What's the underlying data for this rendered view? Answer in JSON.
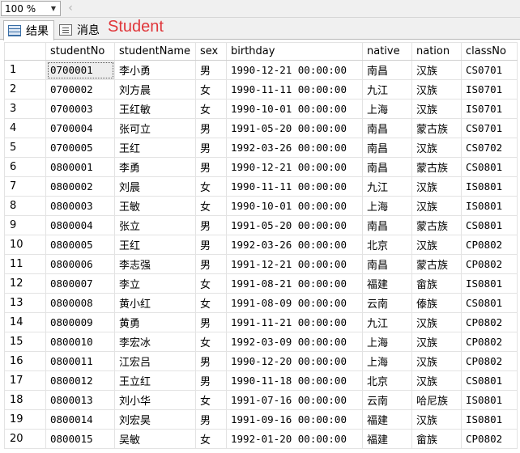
{
  "zoom": {
    "value": "100 %",
    "scroll_glyph": "‹"
  },
  "tabs": [
    {
      "label": "结果"
    },
    {
      "label": "消息"
    }
  ],
  "annotation": "Student",
  "grid": {
    "columns": [
      "studentNo",
      "studentName",
      "sex",
      "birthday",
      "native",
      "nation",
      "classNo"
    ],
    "rows": [
      [
        "1",
        "0700001",
        "李小勇",
        "男",
        "1990-12-21 00:00:00",
        "南昌",
        "汉族",
        "CS0701"
      ],
      [
        "2",
        "0700002",
        "刘方晨",
        "女",
        "1990-11-11 00:00:00",
        "九江",
        "汉族",
        "IS0701"
      ],
      [
        "3",
        "0700003",
        "王红敏",
        "女",
        "1990-10-01 00:00:00",
        "上海",
        "汉族",
        "IS0701"
      ],
      [
        "4",
        "0700004",
        "张可立",
        "男",
        "1991-05-20 00:00:00",
        "南昌",
        "蒙古族",
        "CS0701"
      ],
      [
        "5",
        "0700005",
        "王红",
        "男",
        "1992-03-26 00:00:00",
        "南昌",
        "汉族",
        "CS0702"
      ],
      [
        "6",
        "0800001",
        "李勇",
        "男",
        "1990-12-21 00:00:00",
        "南昌",
        "蒙古族",
        "CS0801"
      ],
      [
        "7",
        "0800002",
        "刘晨",
        "女",
        "1990-11-11 00:00:00",
        "九江",
        "汉族",
        "IS0801"
      ],
      [
        "8",
        "0800003",
        "王敏",
        "女",
        "1990-10-01 00:00:00",
        "上海",
        "汉族",
        "IS0801"
      ],
      [
        "9",
        "0800004",
        "张立",
        "男",
        "1991-05-20 00:00:00",
        "南昌",
        "蒙古族",
        "CS0801"
      ],
      [
        "10",
        "0800005",
        "王红",
        "男",
        "1992-03-26 00:00:00",
        "北京",
        "汉族",
        "CP0802"
      ],
      [
        "11",
        "0800006",
        "李志强",
        "男",
        "1991-12-21 00:00:00",
        "南昌",
        "蒙古族",
        "CP0802"
      ],
      [
        "12",
        "0800007",
        "李立",
        "女",
        "1991-08-21 00:00:00",
        "福建",
        "畲族",
        "IS0801"
      ],
      [
        "13",
        "0800008",
        "黄小红",
        "女",
        "1991-08-09 00:00:00",
        "云南",
        "傣族",
        "CS0801"
      ],
      [
        "14",
        "0800009",
        "黄勇",
        "男",
        "1991-11-21 00:00:00",
        "九江",
        "汉族",
        "CP0802"
      ],
      [
        "15",
        "0800010",
        "李宏冰",
        "女",
        "1992-03-09 00:00:00",
        "上海",
        "汉族",
        "CP0802"
      ],
      [
        "16",
        "0800011",
        "江宏吕",
        "男",
        "1990-12-20 00:00:00",
        "上海",
        "汉族",
        "CP0802"
      ],
      [
        "17",
        "0800012",
        "王立红",
        "男",
        "1990-11-18 00:00:00",
        "北京",
        "汉族",
        "CS0801"
      ],
      [
        "18",
        "0800013",
        "刘小华",
        "女",
        "1991-07-16 00:00:00",
        "云南",
        "哈尼族",
        "IS0801"
      ],
      [
        "19",
        "0800014",
        "刘宏昊",
        "男",
        "1991-09-16 00:00:00",
        "福建",
        "汉族",
        "IS0801"
      ],
      [
        "20",
        "0800015",
        "吴敏",
        "女",
        "1992-01-20 00:00:00",
        "福建",
        "畲族",
        "CP0802"
      ]
    ]
  }
}
